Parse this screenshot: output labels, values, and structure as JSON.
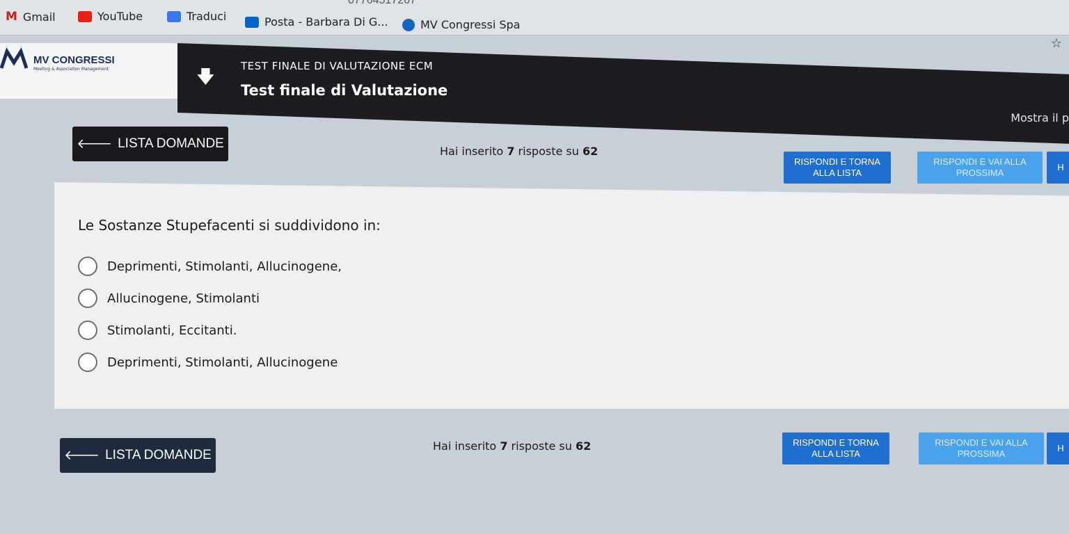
{
  "browser": {
    "url_fragment": "07764517267",
    "bookmarks": [
      {
        "label": "Gmail",
        "icon": "gmail-icon",
        "color": "#c5221f"
      },
      {
        "label": "YouTube",
        "icon": "youtube-icon",
        "color": "#e62117"
      },
      {
        "label": "Traduci",
        "icon": "translate-icon",
        "color": "#3b78e7"
      },
      {
        "label": "Posta - Barbara Di G...",
        "icon": "outlook-icon",
        "color": "#0a64c8"
      },
      {
        "label": "MV Congressi Spa",
        "icon": "mv-icon",
        "color": "#1565c0"
      }
    ]
  },
  "site": {
    "logo_title": "MV CONGRESSI",
    "logo_subtitle": "Meeting & Association Management",
    "course_tag": "TEST FINALE DI VALUTAZIONE ECM",
    "course_title": "Test finale di Valutazione",
    "show_link": "Mostra il p"
  },
  "toolbar": {
    "back_label": "LISTA DOMANDE",
    "count_prefix": "Hai inserito",
    "count_value": "7",
    "count_middle": "risposte su",
    "count_total": "62",
    "answer_back_label": "RISPONDI E TORNA ALLA LISTA",
    "answer_next_label": "RISPONDI E VAI ALLA PROSSIMA",
    "extra_label": "H"
  },
  "question": {
    "text": "Le Sostanze Stupefacenti si suddividono in:",
    "options": [
      "Deprimenti, Stimolanti, Allucinogene,",
      "Allucinogene, Stimolanti",
      "Stimolanti, Eccitanti.",
      "Deprimenti, Stimolanti, Allucinogene"
    ]
  }
}
